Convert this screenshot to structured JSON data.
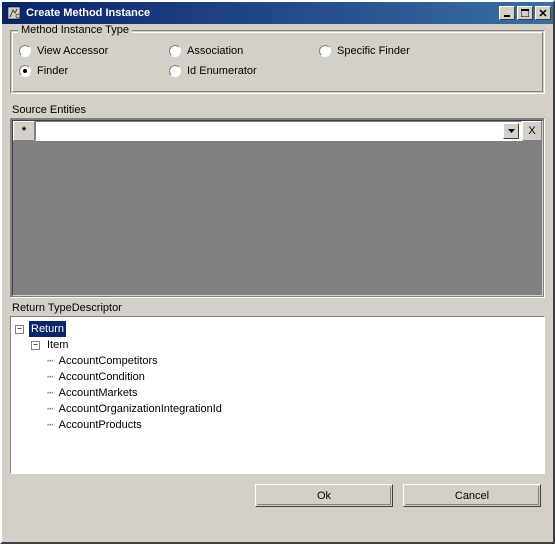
{
  "window": {
    "title": "Create Method Instance"
  },
  "groups": {
    "method_type": {
      "legend": "Method Instance Type",
      "options": {
        "view_accessor": "View Accessor",
        "association": "Association",
        "specific_finder": "Specific Finder",
        "finder": "Finder",
        "id_enumerator": "Id Enumerator"
      }
    },
    "source_entities": {
      "label": "Source Entities",
      "asterisk": "*",
      "delete_x": "X"
    },
    "return_type": {
      "label": "Return TypeDescriptor",
      "tree": {
        "root": "Return",
        "item": "Item",
        "leaves": [
          "AccountCompetitors",
          "AccountCondition",
          "AccountMarkets",
          "AccountOrganizationIntegrationId",
          "AccountProducts"
        ]
      }
    }
  },
  "buttons": {
    "ok": "Ok",
    "cancel": "Cancel"
  }
}
